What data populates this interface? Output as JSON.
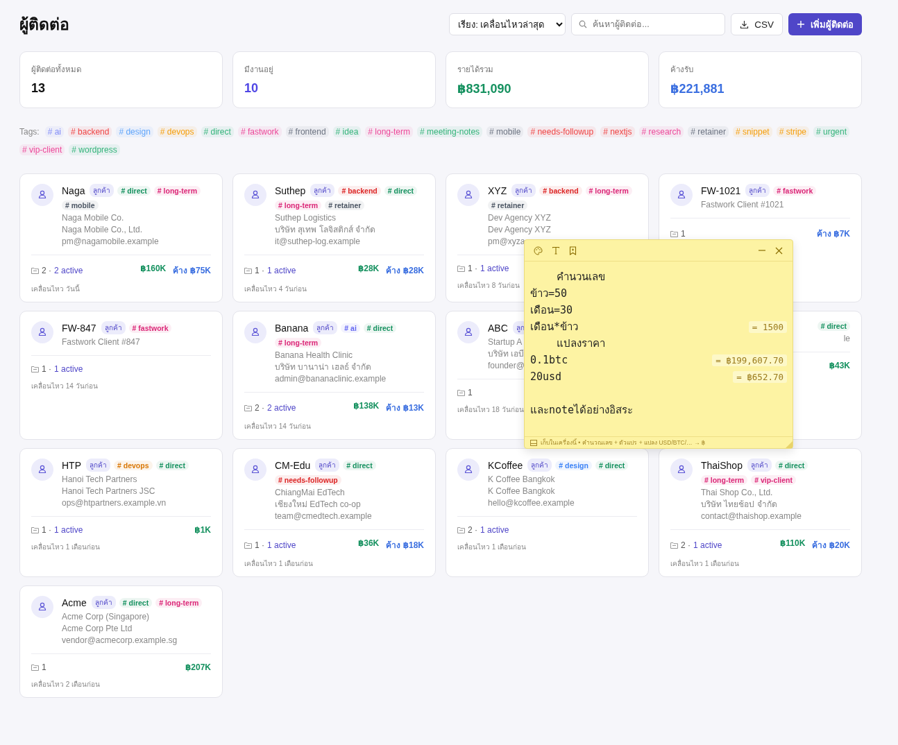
{
  "title": "ผู้ติดต่อ",
  "toolbar": {
    "sort": "เรียง: เคลื่อนไหวล่าสุด",
    "search_placeholder": "ค้นหาผู้ติดต่อ...",
    "export": "CSV",
    "add": "เพิ่มผู้ติดต่อ"
  },
  "stats": [
    {
      "label": "ผู้ติดต่อทั้งหมด",
      "value": "13",
      "color": "#111111"
    },
    {
      "label": "มีงานอยู่",
      "value": "10",
      "color": "#4f46e5"
    },
    {
      "label": "รายได้รวม",
      "value": "฿831,090",
      "color": "#15915f"
    },
    {
      "label": "ค้างรับ",
      "value": "฿221,881",
      "color": "#3b6fe0"
    }
  ],
  "tags_label": "Tags:",
  "tags": [
    {
      "label": "# ai",
      "color": "#818cf8"
    },
    {
      "label": "# backend",
      "color": "#ef4444"
    },
    {
      "label": "# design",
      "color": "#60a5fa"
    },
    {
      "label": "# devops",
      "color": "#f59e0b"
    },
    {
      "label": "# direct",
      "color": "#34b37a"
    },
    {
      "label": "# fastwork",
      "color": "#ec4899"
    },
    {
      "label": "# frontend",
      "color": "#6b7280"
    },
    {
      "label": "# idea",
      "color": "#34b37a"
    },
    {
      "label": "# long-term",
      "color": "#ec4899"
    },
    {
      "label": "# meeting-notes",
      "color": "#34b37a"
    },
    {
      "label": "# mobile",
      "color": "#6b7280"
    },
    {
      "label": "# needs-followup",
      "color": "#ef4444"
    },
    {
      "label": "# nextjs",
      "color": "#ef4444"
    },
    {
      "label": "# research",
      "color": "#ec4899"
    },
    {
      "label": "# retainer",
      "color": "#6b7280"
    },
    {
      "label": "# snippet",
      "color": "#f59e0b"
    },
    {
      "label": "# stripe",
      "color": "#f59e0b"
    },
    {
      "label": "# urgent",
      "color": "#34b37a"
    },
    {
      "label": "# vip-client",
      "color": "#ec4899"
    },
    {
      "label": "# wordpress",
      "color": "#34b37a"
    }
  ],
  "contacts": [
    {
      "name": "Naga",
      "tags": [
        {
          "kind": "customer",
          "label": "ลูกค้า"
        },
        {
          "kind": "hashtag",
          "label": "# direct",
          "color": "#15915f"
        },
        {
          "kind": "hashtag",
          "label": "# long-term",
          "color": "#db2777"
        },
        {
          "kind": "hashtag",
          "label": "# mobile",
          "color": "#4b5563"
        }
      ],
      "lines": [
        "Naga Mobile Co.",
        "Naga Mobile Co., Ltd.",
        "pm@nagamobile.example"
      ],
      "count": "2 ·",
      "active": "2 active",
      "revenue": "฿160K",
      "owed": "ค้าง ฿75K",
      "moved": "เคลื่อนไหว วันนี้"
    },
    {
      "name": "Suthep",
      "tags": [
        {
          "kind": "customer",
          "label": "ลูกค้า"
        },
        {
          "kind": "hashtag",
          "label": "# backend",
          "color": "#dc2626"
        },
        {
          "kind": "hashtag",
          "label": "# direct",
          "color": "#15915f"
        },
        {
          "kind": "hashtag",
          "label": "# long-term",
          "color": "#db2777"
        },
        {
          "kind": "hashtag",
          "label": "# retainer",
          "color": "#4b5563"
        }
      ],
      "lines": [
        "Suthep Logistics",
        "บริษัท สุเทพ โลจิสติกส์ จำกัด",
        "it@suthep-log.example"
      ],
      "count": "1 ·",
      "active": "1 active",
      "revenue": "฿28K",
      "owed": "ค้าง ฿28K",
      "moved": "เคลื่อนไหว 4 วันก่อน"
    },
    {
      "name": "XYZ",
      "tags": [
        {
          "kind": "customer",
          "label": "ลูกค้า"
        },
        {
          "kind": "hashtag",
          "label": "# backend",
          "color": "#dc2626"
        },
        {
          "kind": "hashtag",
          "label": "# long-term",
          "color": "#db2777"
        },
        {
          "kind": "hashtag",
          "label": "# retainer",
          "color": "#4b5563"
        }
      ],
      "lines": [
        "Dev Agency XYZ",
        "Dev Agency XYZ",
        "pm@xyza"
      ],
      "count": "1 ·",
      "active": "1 active",
      "moved": "เคลื่อนไหว 8 วันก่อน"
    },
    {
      "name": "FW-1021",
      "tags": [
        {
          "kind": "customer",
          "label": "ลูกค้า"
        },
        {
          "kind": "hashtag",
          "label": "# fastwork",
          "color": "#db2777"
        }
      ],
      "lines": [
        "Fastwork Client #1021"
      ],
      "count": "1",
      "owed": "ค้าง ฿7K"
    },
    {
      "name": "FW-847",
      "tags": [
        {
          "kind": "customer",
          "label": "ลูกค้า"
        },
        {
          "kind": "hashtag",
          "label": "# fastwork",
          "color": "#db2777"
        }
      ],
      "lines": [
        "Fastwork Client #847"
      ],
      "count": "1 ·",
      "active": "1 active",
      "moved": "เคลื่อนไหว 14 วันก่อน"
    },
    {
      "name": "Banana",
      "tags": [
        {
          "kind": "customer",
          "label": "ลูกค้า"
        },
        {
          "kind": "hashtag",
          "label": "# ai",
          "color": "#6366f1"
        },
        {
          "kind": "hashtag",
          "label": "# direct",
          "color": "#15915f"
        },
        {
          "kind": "hashtag",
          "label": "# long-term",
          "color": "#db2777"
        }
      ],
      "lines": [
        "Banana Health Clinic",
        "บริษัท บานาน่า เฮลธ์ จำกัด",
        "admin@bananaclinic.example"
      ],
      "count": "2 ·",
      "active": "2 active",
      "revenue": "฿138K",
      "owed": "ค้าง ฿13K",
      "moved": "เคลื่อนไหว 14 วันก่อน"
    },
    {
      "name": "ABC",
      "tags": [
        {
          "kind": "customer",
          "label": "ลูก"
        }
      ],
      "lines": [
        "Startup A",
        "บริษัท เอบี",
        "founder@"
      ],
      "count": "1",
      "moved": "เคลื่อนไหว 18 วันก่อน"
    },
    {
      "tags": [
        {
          "kind": "hashtag",
          "label": "# direct",
          "color": "#15915f"
        }
      ],
      "lines": [
        "le"
      ],
      "revenue": "฿43K"
    },
    {
      "name": "HTP",
      "tags": [
        {
          "kind": "customer",
          "label": "ลูกค้า"
        },
        {
          "kind": "hashtag",
          "label": "# devops",
          "color": "#d97706"
        },
        {
          "kind": "hashtag",
          "label": "# direct",
          "color": "#15915f"
        }
      ],
      "lines": [
        "Hanoi Tech Partners",
        "Hanoi Tech Partners JSC",
        "ops@htpartners.example.vn"
      ],
      "count": "1 ·",
      "active": "1 active",
      "revenue": "฿1K",
      "moved": "เคลื่อนไหว 1 เดือนก่อน"
    },
    {
      "name": "CM-Edu",
      "tags": [
        {
          "kind": "customer",
          "label": "ลูกค้า"
        },
        {
          "kind": "hashtag",
          "label": "# direct",
          "color": "#15915f"
        },
        {
          "kind": "hashtag",
          "label": "# needs-followup",
          "color": "#dc2626"
        }
      ],
      "lines": [
        "ChiangMai EdTech",
        "เชียงใหม่ EdTech co-op",
        "team@cmedtech.example"
      ],
      "count": "1 ·",
      "active": "1 active",
      "revenue": "฿36K",
      "owed": "ค้าง ฿18K",
      "moved": "เคลื่อนไหว 1 เดือนก่อน"
    },
    {
      "name": "KCoffee",
      "tags": [
        {
          "kind": "customer",
          "label": "ลูกค้า"
        },
        {
          "kind": "hashtag",
          "label": "# design",
          "color": "#3b82f6"
        },
        {
          "kind": "hashtag",
          "label": "# direct",
          "color": "#15915f"
        }
      ],
      "lines": [
        "K Coffee Bangkok",
        "K Coffee Bangkok",
        "hello@kcoffee.example"
      ],
      "count": "2 ·",
      "active": "1 active",
      "moved": "เคลื่อนไหว 1 เดือนก่อน"
    },
    {
      "name": "ThaiShop",
      "tags": [
        {
          "kind": "customer",
          "label": "ลูกค้า"
        },
        {
          "kind": "hashtag",
          "label": "# direct",
          "color": "#15915f"
        },
        {
          "kind": "hashtag",
          "label": "# long-term",
          "color": "#db2777"
        },
        {
          "kind": "hashtag",
          "label": "# vip-client",
          "color": "#db2777"
        }
      ],
      "lines": [
        "Thai Shop Co., Ltd.",
        "บริษัท ไทยช้อป จำกัด",
        "contact@thaishop.example"
      ],
      "count": "2 ·",
      "active": "1 active",
      "revenue": "฿110K",
      "owed": "ค้าง ฿20K",
      "moved": "เคลื่อนไหว 1 เดือนก่อน"
    },
    {
      "name": "Acme",
      "tags": [
        {
          "kind": "customer",
          "label": "ลูกค้า"
        },
        {
          "kind": "hashtag",
          "label": "# direct",
          "color": "#15915f"
        },
        {
          "kind": "hashtag",
          "label": "# long-term",
          "color": "#db2777"
        }
      ],
      "lines": [
        "Acme Corp (Singapore)",
        "Acme Corp Pte Ltd",
        "vendor@acmecorp.example.sg"
      ],
      "count": "1",
      "revenue": "฿207K",
      "moved": "เคลื่อนไหว 2 เดือนก่อน"
    }
  ],
  "note": {
    "lines": [
      {
        "kind": "heading",
        "text": "คำนวนเลข"
      },
      {
        "kind": "text",
        "text": "ข้าว=50"
      },
      {
        "kind": "text",
        "text": "เดือน=30"
      },
      {
        "kind": "text",
        "text": "เดือน*ข้าว",
        "result": "= 1500"
      },
      {
        "kind": "heading",
        "text": "แปลงราคา"
      },
      {
        "kind": "text",
        "text": "0.1btc",
        "result": "= ฿199,607.70"
      },
      {
        "kind": "text",
        "text": "20usd",
        "result": "= ฿652.70"
      },
      {
        "kind": "blank"
      },
      {
        "kind": "text",
        "text": "และnoteได้อย่างอิสระ"
      }
    ],
    "footer": "เก็บในเครื่องนี้ • คำนวณเลข + ตัวแปร + แปลง USD/BTC/… → ฿"
  }
}
